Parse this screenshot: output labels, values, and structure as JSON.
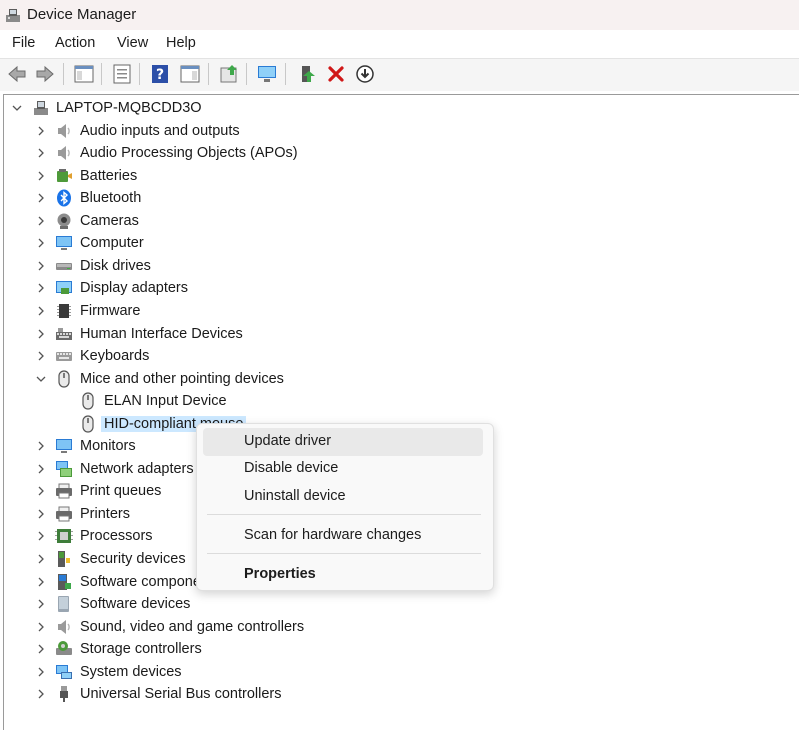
{
  "window": {
    "title": "Device Manager"
  },
  "menus": [
    "File",
    "Action",
    "View",
    "Help"
  ],
  "toolbar": [
    {
      "name": "back-arrow-icon"
    },
    {
      "name": "forward-arrow-icon"
    },
    {
      "name": "show-hide-console-tree-icon"
    },
    {
      "name": "properties-icon"
    },
    {
      "name": "help-icon"
    },
    {
      "name": "action-pane-icon"
    },
    {
      "name": "update-driver-icon"
    },
    {
      "name": "scan-hardware-icon"
    },
    {
      "name": "enable-device-icon"
    },
    {
      "name": "uninstall-device-icon"
    },
    {
      "name": "disable-device-icon"
    }
  ],
  "tree": {
    "root": "LAPTOP-MQBCDD3O",
    "categories": [
      {
        "label": "Audio inputs and outputs",
        "icon": "speaker-icon"
      },
      {
        "label": "Audio Processing Objects (APOs)",
        "icon": "speaker-icon"
      },
      {
        "label": "Batteries",
        "icon": "battery-icon"
      },
      {
        "label": "Bluetooth",
        "icon": "bluetooth-icon"
      },
      {
        "label": "Cameras",
        "icon": "camera-icon"
      },
      {
        "label": "Computer",
        "icon": "computer-icon"
      },
      {
        "label": "Disk drives",
        "icon": "disk-drive-icon"
      },
      {
        "label": "Display adapters",
        "icon": "display-adapter-icon"
      },
      {
        "label": "Firmware",
        "icon": "firmware-chip-icon"
      },
      {
        "label": "Human Interface Devices",
        "icon": "hid-icon"
      },
      {
        "label": "Keyboards",
        "icon": "keyboard-icon"
      },
      {
        "label": "Mice and other pointing devices",
        "icon": "mouse-icon",
        "expanded": true,
        "children": [
          {
            "label": "ELAN Input Device",
            "icon": "mouse-icon"
          },
          {
            "label": "HID-compliant mouse",
            "icon": "mouse-icon",
            "selected": true
          }
        ]
      },
      {
        "label": "Monitors",
        "icon": "monitor-icon"
      },
      {
        "label": "Network adapters",
        "icon": "network-adapter-icon"
      },
      {
        "label": "Print queues",
        "icon": "printer-icon"
      },
      {
        "label": "Printers",
        "icon": "printer-icon"
      },
      {
        "label": "Processors",
        "icon": "processor-icon"
      },
      {
        "label": "Security devices",
        "icon": "security-device-icon"
      },
      {
        "label": "Software components",
        "icon": "software-component-icon"
      },
      {
        "label": "Software devices",
        "icon": "software-device-icon"
      },
      {
        "label": "Sound, video and game controllers",
        "icon": "speaker-icon"
      },
      {
        "label": "Storage controllers",
        "icon": "storage-controller-icon"
      },
      {
        "label": "System devices",
        "icon": "system-device-icon"
      },
      {
        "label": "Universal Serial Bus controllers",
        "icon": "usb-icon"
      }
    ]
  },
  "context_menu": {
    "items": [
      {
        "label": "Update driver",
        "hover": true
      },
      {
        "label": "Disable device"
      },
      {
        "label": "Uninstall device"
      },
      {
        "label": "Scan for hardware changes"
      },
      {
        "label": "Properties",
        "bold": true
      }
    ]
  },
  "colors": {
    "selection": "#cce8ff",
    "accent": "#0078d4"
  }
}
